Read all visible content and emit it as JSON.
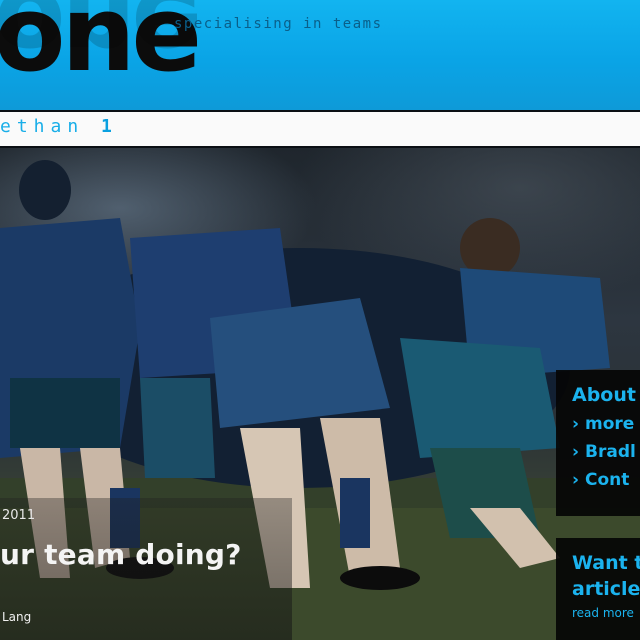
{
  "header": {
    "logo_text": "one",
    "tagline": "specialising in teams"
  },
  "strip": {
    "prefix": "ethan",
    "suffix": "1"
  },
  "about_panel": {
    "title": "About",
    "links": [
      "more",
      "Bradl",
      "Cont"
    ]
  },
  "cta_panel": {
    "line1": "Want t",
    "line2": "article",
    "link": "read more"
  },
  "article": {
    "date": "2011",
    "headline": "ur team doing?",
    "author": "Lang"
  },
  "colors": {
    "brand_blue": "#12b4f0",
    "accent_text": "#1bb3ee",
    "panel_bg": "#050505"
  },
  "icons": {
    "link_bullet": "chevron-right-icon"
  }
}
